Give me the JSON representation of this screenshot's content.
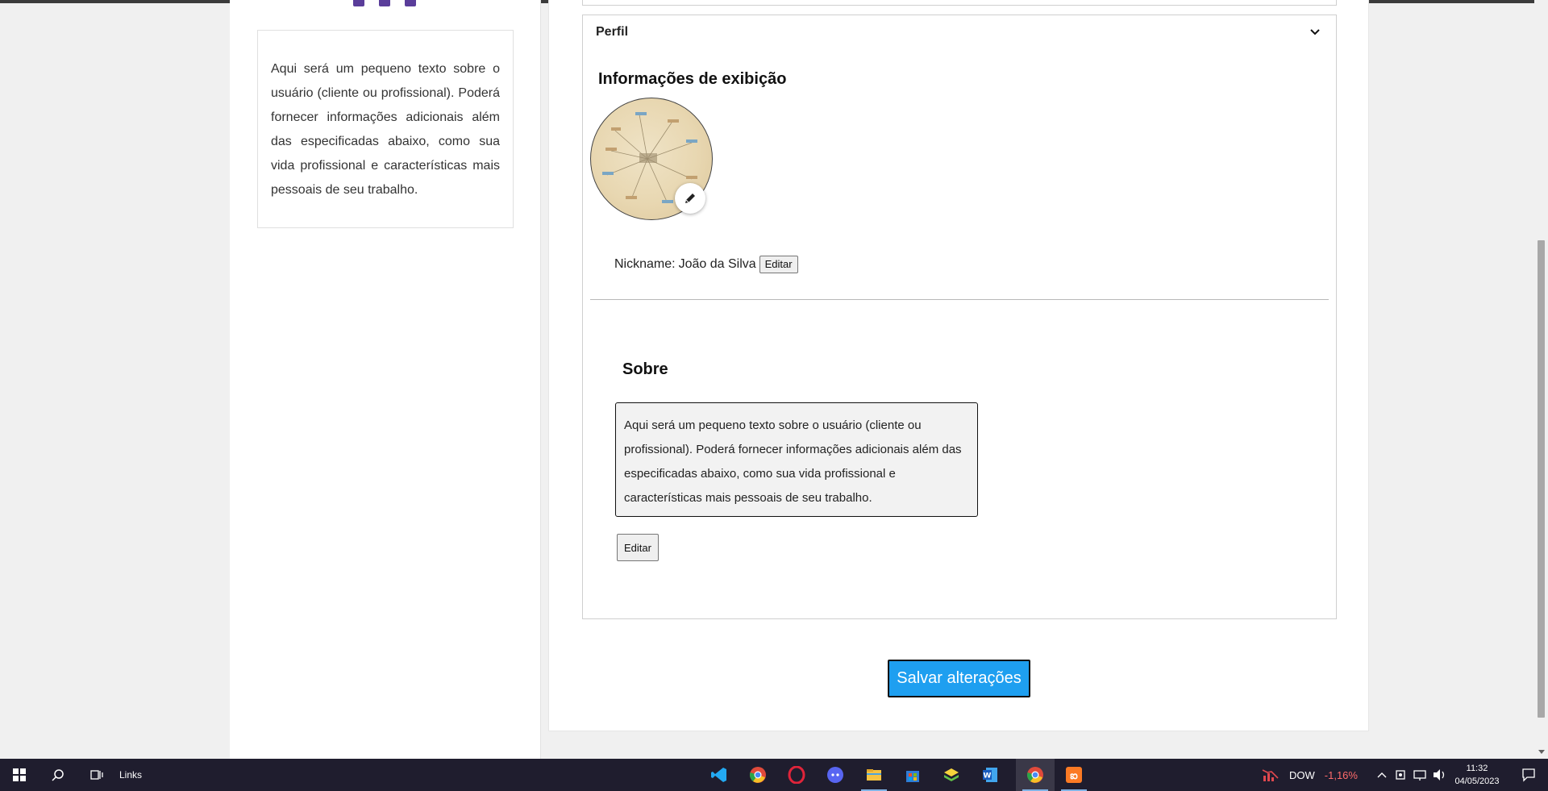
{
  "sidebar": {
    "about_text": "Aqui será um pequeno texto sobre o usuário (cliente ou profissional). Poderá fornecer informações adicionais além das especificadas abaixo, como sua vida profissional e características mais pessoais de seu trabalho."
  },
  "perfil": {
    "section_label": "Perfil",
    "display_title": "Informações de exibição",
    "nickname_label": "Nickname:",
    "nickname_value": "João da Silva",
    "nickname_edit": "Editar",
    "sobre_title": "Sobre",
    "sobre_text": "Aqui será um pequeno texto sobre o usuário (cliente ou profissional). Poderá fornecer informações adicionais além das especificadas abaixo, como sua vida profissional e características mais pessoais de seu trabalho.",
    "sobre_edit": "Editar"
  },
  "actions": {
    "save_label": "Salvar alterações"
  },
  "colors": {
    "accent": "#1e9ff0",
    "social": "#5a3d9a"
  },
  "taskbar": {
    "links_label": "Links",
    "apps": [
      "vscode-icon",
      "chrome-icon",
      "opera-icon",
      "discord-icon",
      "file-explorer-icon",
      "store-icon",
      "bluestacks-icon",
      "word-icon",
      "chrome-profile-icon",
      "xampp-icon"
    ],
    "ticker_symbol": "DOW",
    "ticker_change": "-1,16%",
    "time": "11:32",
    "date": "04/05/2023"
  }
}
